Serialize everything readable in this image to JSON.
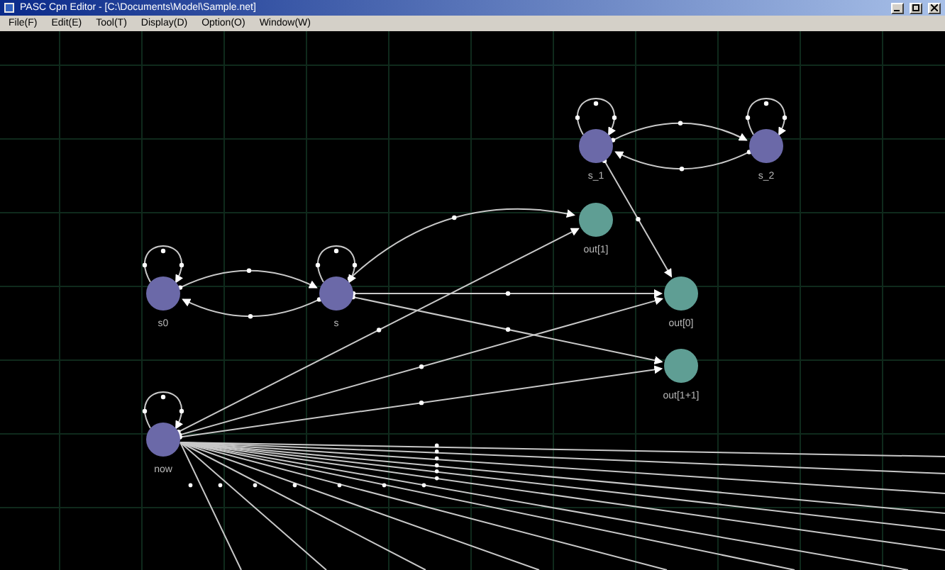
{
  "window": {
    "title": "PASC Cpn Editor - [C:\\Documents\\Model\\Sample.net]"
  },
  "menu": [
    "File(F)",
    "Edit(E)",
    "Tool(T)",
    "Display(D)",
    "Option(O)",
    "Window(W)"
  ],
  "nodes": [
    {
      "label": "s0",
      "color": "#6b69a8"
    },
    {
      "label": "s",
      "color": "#6b69a8"
    },
    {
      "label": "s_1",
      "color": "#6b69a8"
    },
    {
      "label": "s_2",
      "color": "#6b69a8"
    },
    {
      "label": "out[1]",
      "color": "#5f9e94"
    },
    {
      "label": "out[0]",
      "color": "#5f9e94"
    },
    {
      "label": "out[1+1]",
      "color": "#5f9e94"
    },
    {
      "label": "now",
      "color": "#6b69a8"
    }
  ]
}
